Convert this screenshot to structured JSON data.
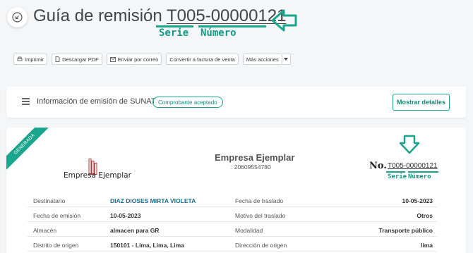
{
  "header": {
    "title_prefix": "Guía de remisión",
    "document_id": "T005-00000121",
    "serie_annotation": "Serie",
    "numero_annotation": "Número"
  },
  "toolbar": {
    "print_label": "Imprimir",
    "download_label": "Descargar PDF",
    "email_label": "Enviar por correo",
    "convert_label": "Convertir a factura de venta",
    "more_label": "Más acciones"
  },
  "sunat": {
    "label": "Información de emisión de SUNAT",
    "status_badge": "Comprobante aceptado",
    "details_button": "Mostrar detalles"
  },
  "document": {
    "ribbon": "GENERADA",
    "logo_text": "Empresa Ejemplar",
    "company_name": "Empresa Ejemplar",
    "company_ruc": ": 20609554780",
    "no_label": "No.",
    "no_value": "T005-00000121",
    "serie_annotation": "Serie",
    "numero_annotation": "Número",
    "fields_left": [
      {
        "label": "Destinatario",
        "value": "DIAZ DIOSES MIRTA VIOLETA"
      },
      {
        "label": "Fecha de emisión",
        "value": "10-05-2023"
      },
      {
        "label": "Almacén",
        "value": "almacen para GR"
      },
      {
        "label": "Distrito de origen",
        "value": "150101 - Lima, Lima, Lima"
      }
    ],
    "fields_right": [
      {
        "label": "Fecha de traslado",
        "value": "10-05-2023"
      },
      {
        "label": "Motivo del traslado",
        "value": "Otros"
      },
      {
        "label": "Modalidad",
        "value": "Transporte público"
      },
      {
        "label": "Dirección de origen",
        "value": "lima"
      }
    ]
  },
  "colors": {
    "accent": "#1aa58d",
    "background": "#f5f6f8"
  }
}
